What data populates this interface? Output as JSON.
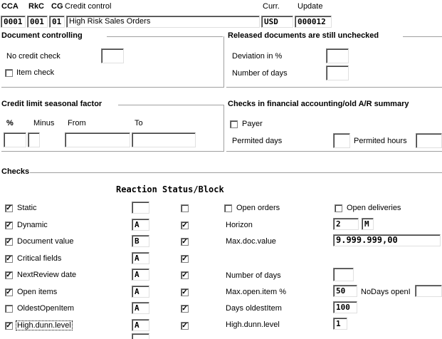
{
  "header": {
    "cca_label": "CCA",
    "rkc_label": "RkC",
    "cg_label": "CG",
    "credit_control_label": "Credit control",
    "curr_label": "Curr.",
    "update_label": "Update",
    "cca_value": "0001",
    "rkc_value": "001",
    "cg_value": "01",
    "credit_control_value": "High Risk Sales Orders",
    "curr_value": "USD",
    "update_value": "000012"
  },
  "document_controlling": {
    "title": "Document controlling",
    "no_credit_check_label": "No credit check",
    "no_credit_check_value": "",
    "item_check_label": "Item check",
    "item_check_checked": false
  },
  "released_documents": {
    "title": "Released documents are still unchecked",
    "deviation_label": "Deviation in %",
    "deviation_value": "",
    "number_of_days_label": "Number of days",
    "number_of_days_value": ""
  },
  "seasonal_factor": {
    "title": "Credit limit seasonal factor",
    "percent_label": "%",
    "minus_label": "Minus",
    "from_label": "From",
    "to_label": "To"
  },
  "financial_checks": {
    "title": "Checks in financial accounting/old A/R summary",
    "payer_label": "Payer",
    "payer_checked": false,
    "permitted_days_label": "Permited days",
    "permitted_hours_label": "Permited hours"
  },
  "checks": {
    "title": "Checks",
    "column_header": "Reaction Status/Block",
    "rows": [
      {
        "label": "Static",
        "checked": true,
        "reaction": "",
        "status": false
      },
      {
        "label": "Dynamic",
        "checked": true,
        "reaction": "A",
        "status": true
      },
      {
        "label": "Document value",
        "checked": true,
        "reaction": "B",
        "status": true
      },
      {
        "label": "Critical fields",
        "checked": true,
        "reaction": "A",
        "status": true
      },
      {
        "label": "NextReview date",
        "checked": true,
        "reaction": "A",
        "status": true
      },
      {
        "label": "Open items",
        "checked": true,
        "reaction": "A",
        "status": true
      },
      {
        "label": "OldestOpenItem",
        "checked": false,
        "reaction": "A",
        "status": true
      },
      {
        "label": "High.dunn.level",
        "checked": true,
        "reaction": "A",
        "status": true
      }
    ],
    "open_orders_label": "Open orders",
    "open_deliveries_label": "Open deliveries",
    "horizon_label": "Horizon",
    "horizon_value": "2",
    "horizon_unit": "M",
    "max_doc_value_label": "Max.doc.value",
    "max_doc_value_value": "9.999.999,00",
    "review_days_label": "Number of days",
    "review_days_value": "",
    "max_open_item_label": "Max.open.item %",
    "max_open_item_value": "50",
    "no_days_open_label": "NoDays openI",
    "days_oldest_item_label": "Days oldestItem",
    "days_oldest_item_value": "100",
    "high_dunn_level_label": "High.dunn.level",
    "high_dunn_level_value": "1"
  }
}
